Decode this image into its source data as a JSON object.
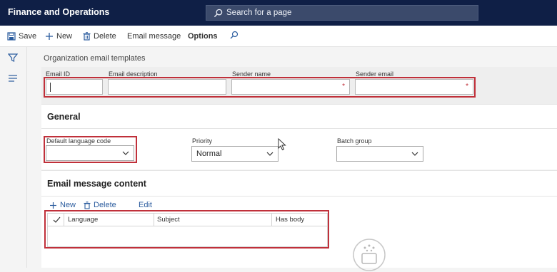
{
  "app": {
    "title": "Finance and Operations"
  },
  "search": {
    "placeholder": "Search for a page"
  },
  "actions": {
    "save": "Save",
    "new": "New",
    "delete": "Delete",
    "email_message": "Email message",
    "options": "Options"
  },
  "rail": {
    "icons": [
      "filter-icon",
      "list-icon"
    ]
  },
  "page": {
    "title": "Organization email templates"
  },
  "header_fields": {
    "email_id": {
      "label": "Email ID",
      "value": ""
    },
    "email_description": {
      "label": "Email description",
      "value": ""
    },
    "sender_name": {
      "label": "Sender name",
      "value": "",
      "required_mark": "*"
    },
    "sender_email": {
      "label": "Sender email",
      "value": "",
      "required_mark": "*"
    }
  },
  "general": {
    "title": "General",
    "default_language": {
      "label": "Default language code",
      "value": ""
    },
    "priority": {
      "label": "Priority",
      "value": "Normal"
    },
    "batch_group": {
      "label": "Batch group",
      "value": ""
    }
  },
  "content": {
    "title": "Email message content",
    "toolbar": {
      "new": "New",
      "delete": "Delete",
      "edit": "Edit"
    },
    "columns": [
      "Language",
      "Subject",
      "Has body"
    ]
  },
  "colors": {
    "appbar": "#0f1f46",
    "highlight": "#c0303a",
    "link": "#2b5c9e"
  }
}
